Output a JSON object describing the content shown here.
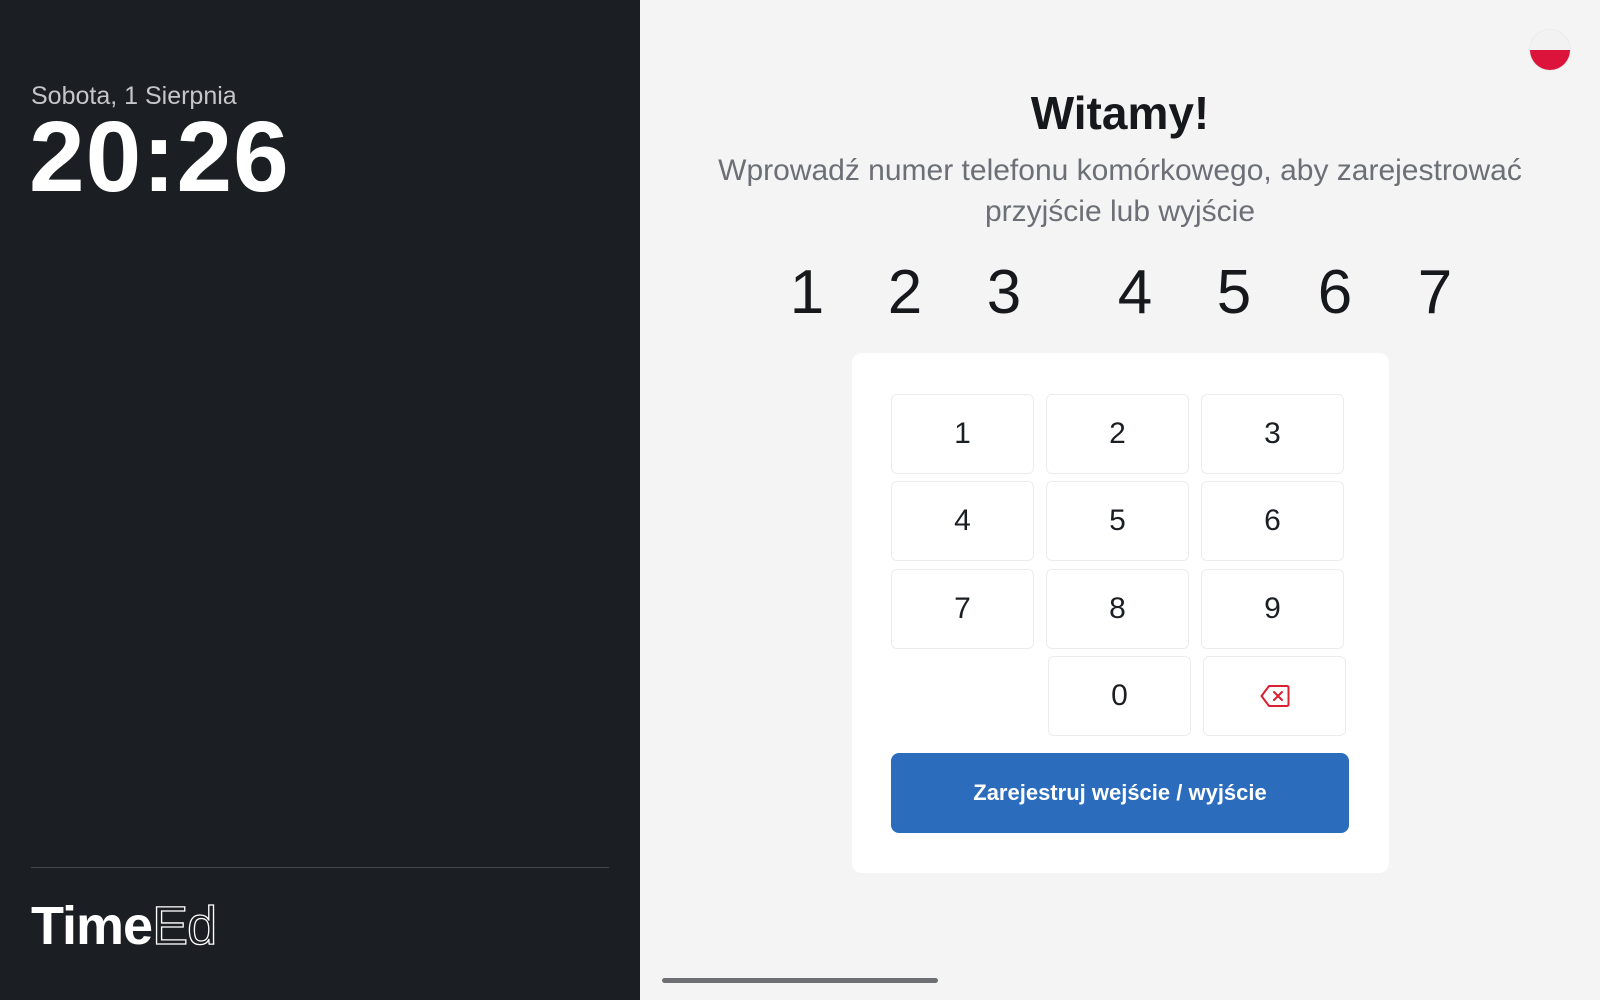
{
  "sidebar": {
    "date": "Sobota, 1 Sierpnia",
    "time": "20:26",
    "brand": {
      "bold": "Time",
      "light": "Ed"
    }
  },
  "main": {
    "title": "Witamy!",
    "subtitle": "Wprowadź numer telefonu komórkowego, aby zarejestrować przyjście lub wyjście",
    "phone_digits": [
      "1",
      "2",
      "3",
      "4",
      "5",
      "6",
      "7"
    ],
    "language_flag": "poland-flag-icon"
  },
  "keypad": {
    "keys": [
      "1",
      "2",
      "3",
      "4",
      "5",
      "6",
      "7",
      "8",
      "9",
      "0"
    ],
    "backspace_icon": "backspace-icon",
    "submit_label": "Zarejestruj wejście / wyjście"
  },
  "colors": {
    "sidebar_bg": "#1b1e22",
    "page_bg": "#f4f4f5",
    "accent": "#2b6cbd",
    "danger": "#d92032"
  }
}
